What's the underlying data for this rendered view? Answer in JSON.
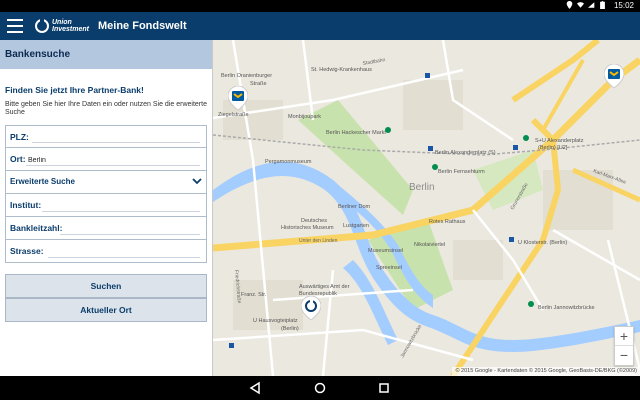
{
  "status_bar": {
    "time": "15:02"
  },
  "app_bar": {
    "brand_line1": "Union",
    "brand_line2": "Investment",
    "title": "Meine Fondswelt"
  },
  "panel": {
    "header": "Bankensuche",
    "headline": "Finden Sie jetzt Ihre Partner-Bank!",
    "instructions": "Bitte geben Sie hier Ihre Daten ein oder nutzen Sie die erweiterte Suche",
    "fields": {
      "plz": {
        "label": "PLZ:",
        "value": ""
      },
      "ort": {
        "label": "Ort:",
        "value": "Berlin"
      },
      "advanced": {
        "label": "Erweiterte Suche"
      },
      "institut": {
        "label": "Institut:",
        "value": ""
      },
      "bankleitzahl": {
        "label": "Bankleitzahl:",
        "value": ""
      },
      "strasse": {
        "label": "Strasse:",
        "value": ""
      }
    },
    "buttons": {
      "search": "Suchen",
      "location": "Aktueller Ort"
    }
  },
  "map": {
    "labels": {
      "berlin": "Berlin",
      "oranienburger": "Berlin Oranienburger",
      "strasse": "Straße",
      "hedwig": "St. Hedwig-Krankenhaus",
      "ziegelstrasse": "Ziegelstraße",
      "monbijoupark": "Monbijoupark",
      "hackescher": "Berlin Hackescher Markt",
      "pergamon": "Pergamonmuseum",
      "alexanderplatz_s": "S+U Alexanderplatz",
      "alexanderplatz_s2": "(Berlin) [U2]",
      "alexanderplatz_bf": "Berlin Alexanderplatz (S)",
      "fernsehturm": "Berlin Fernsehturm",
      "dom": "Berliner Dom",
      "lustgarten": "Lustgarten",
      "dhm1": "Deutsches",
      "dhm2": "Historisches Museum",
      "rotes_rathaus": "Rotes Rathaus",
      "unter_den_linden": "Unter den Linden",
      "museumsinsel": "Museumsinsel",
      "nikolaiviertel": "Nikolaiviertel",
      "klosterstrasse": "U Klosterstr. (Berlin)",
      "spreeinsel": "Spreeinsel",
      "janno_str": "Berlin Jannowitzbrücke",
      "auswaertiges1": "Auswärtiges Amt der",
      "auswaertiges2": "Bundesrepublik",
      "hausvogtei1": "U Hausvogteiplatz",
      "hausvogtei2": "(Berlin)",
      "karl_marx": "Karl-Marx-Allee",
      "grunerstr": "Grunerstraße",
      "jannowitz_str": "Jannowitzbrücke",
      "stadtbahn": "Stadtbahn",
      "friedrichstr": "Friedrichstraße",
      "franz": "Franz. Str."
    },
    "zoom_in": "+",
    "zoom_out": "−",
    "attribution": "© 2015 Google - Kartendaten © 2015 Google, GeoBasis-DE/BKG (©2009)"
  },
  "colors": {
    "app_bar": "#0a3d6b",
    "panel_header": "#b3c8de",
    "accent_text": "#0a3d6b",
    "water": "#a3ccff",
    "park": "#c8e2ad",
    "road_major": "#f9d463"
  }
}
